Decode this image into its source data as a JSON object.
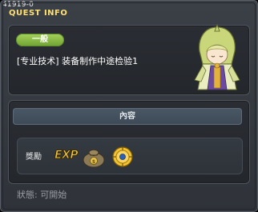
{
  "window": {
    "quest_id": "41919-0",
    "title": "QUEST INFO"
  },
  "quest": {
    "category_badge": "一般",
    "name": "[专业技术] 装备制作中途检验1"
  },
  "content_section": {
    "header": "內容"
  },
  "reward": {
    "label": "獎勵",
    "exp_text": "EXP",
    "items": [
      "exp-icon",
      "meso-bag-icon",
      "gold-coin-icon"
    ]
  },
  "status": {
    "text": "狀態: 可開始"
  }
}
